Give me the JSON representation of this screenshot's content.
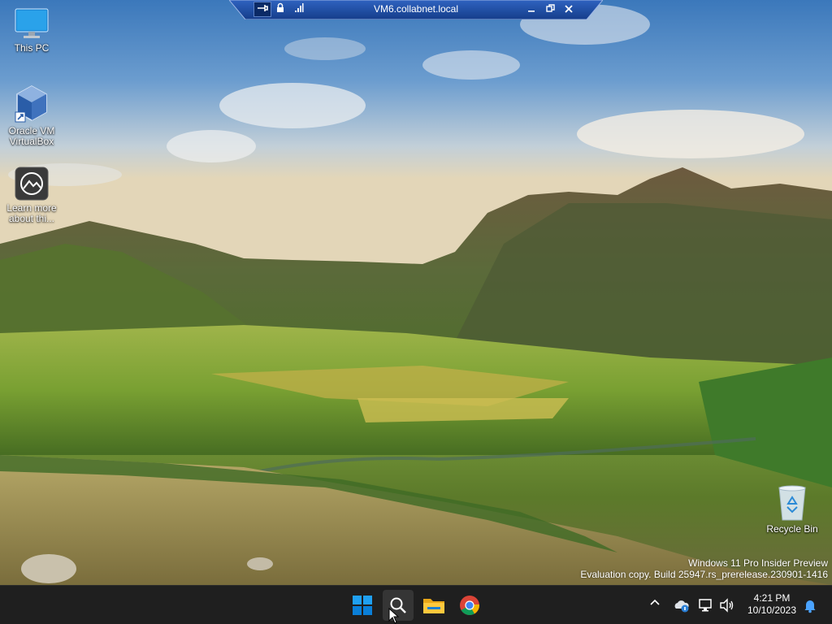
{
  "rdp_bar": {
    "title": "VM6.collabnet.local",
    "pin_icon": "pin-icon",
    "lock_icon": "lock-icon",
    "signal_icon": "signal-icon",
    "minimize_icon": "minimize-icon",
    "restore_icon": "restore-icon",
    "close_icon": "close-icon"
  },
  "desktop_icons": [
    {
      "label": "This PC",
      "icon": "monitor-icon"
    },
    {
      "label": "Oracle VM VirtualBox",
      "icon": "virtualbox-icon"
    },
    {
      "label": "Learn more about thi...",
      "icon": "learn-more-icon"
    },
    {
      "label": "Recycle Bin",
      "icon": "recycle-bin-icon"
    }
  ],
  "watermark": {
    "line1": "Windows 11 Pro Insider Preview",
    "line2": "Evaluation copy. Build 25947.rs_prerelease.230901-1416"
  },
  "taskbar": {
    "apps": [
      {
        "name": "Start",
        "icon": "windows-start-icon"
      },
      {
        "name": "Search",
        "icon": "search-icon"
      },
      {
        "name": "File Explorer",
        "icon": "folder-icon"
      },
      {
        "name": "Google Chrome",
        "icon": "chrome-icon"
      }
    ],
    "tray": {
      "time": "4:21 PM",
      "date": "10/10/2023"
    }
  },
  "colors": {
    "taskbar_bg": "#1f1f1f",
    "rdp_bar_bg": "#1d4fa8",
    "start_blue": "#0a8cf0"
  }
}
